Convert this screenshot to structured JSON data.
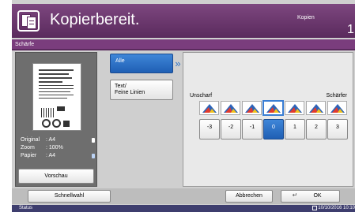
{
  "header": {
    "title": "Kopierbereit.",
    "copies_label": "Kopien",
    "copies_count": "1",
    "icon": "copy-app-icon"
  },
  "section": {
    "tab_label": "Schärfe"
  },
  "preview": {
    "info": [
      {
        "key": "Original",
        "value": ": A4"
      },
      {
        "key": "Zoom",
        "value": ": 100%"
      },
      {
        "key": "Papier",
        "value": ": A4"
      }
    ],
    "button_label": "Vorschau"
  },
  "modes": {
    "all_label": "Alle",
    "text_label_line1": "Text/",
    "text_label_line2": "Feine Linien",
    "selected": "Alle"
  },
  "sharpness": {
    "left_label": "Unscharf",
    "right_label": "Schärfer",
    "values": [
      "-3",
      "-2",
      "-1",
      "0",
      "1",
      "2",
      "3"
    ],
    "selected": "0",
    "icon": "sharpness-swatch-icon"
  },
  "bottom": {
    "quick_label": "Schnellwahl",
    "cancel_label": "Abbrechen",
    "ok_label": "OK"
  },
  "status": {
    "label": "Status",
    "datetime": "10/10/2016  10:10"
  },
  "colors": {
    "header": "#6b3a6e",
    "selected_blue": "#2a6fc9",
    "panel_gray": "#6e6e6e"
  }
}
